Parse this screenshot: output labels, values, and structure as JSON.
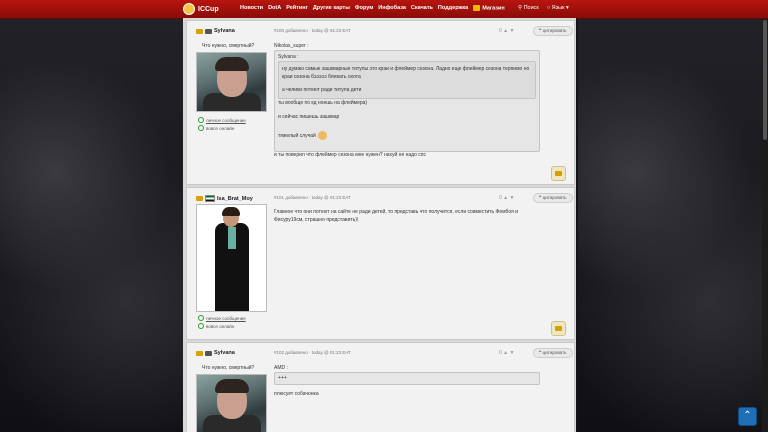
{
  "nav": {
    "logo": "ICCup",
    "items": [
      "Новости",
      "DotA",
      "Рейтинг",
      "Другие карты",
      "Форум",
      "Инфобаза",
      "Скачать",
      "Поддержка",
      "Магазин"
    ],
    "search": "Поиск",
    "language": "Язык"
  },
  "posts": [
    {
      "author": "Sylvana",
      "status": "Что нужно, смертный?",
      "meta": "#100 добавлено · today @ 01:23 EAT",
      "rating": "0",
      "quote_button": "цитировать",
      "quote_author": "Nikolas_super :",
      "inner_quote_author": "Sylvana :",
      "inner_quote_text": "ну думаю самые зашкварные титулы это краи и флеймер сезона. Ладно еще флеймер сезона терпимо но краи сезона бэээээ блевать охота",
      "inner_quote_line2": "а челики потеют ради титула дети",
      "quote_body": [
        "ты вообще по кд ноешь на флеймера)",
        "и сейчас пишешь зашквар",
        "тяжелый случай"
      ],
      "reply": "и ты поверил что флеймер сезона мне нужен? нахуй не надо спс",
      "private_message": "личное сообщение",
      "online": "вовсе онлайн"
    },
    {
      "author": "Isa_Brat_Moy",
      "meta": "#101 добавлено · today @ 01:23 EAT",
      "rating": "0",
      "quote_button": "цитировать",
      "body": "Главное что они потеют на сайте не ради детей, то представь что получится, если совместить Фембоя и Фисуру19см, страшно представить)\\",
      "private_message": "личное сообщение",
      "online": "вовсе онлайн"
    },
    {
      "author": "Sylvana",
      "status": "Что нужно, смертный?",
      "meta": "#102 добавлено · today @ 01:23 EAT",
      "rating": "0",
      "quote_button": "цитировать",
      "quote_author": "AMD :",
      "quote_text": "+++",
      "reply": "плюсует собачонка"
    }
  ]
}
